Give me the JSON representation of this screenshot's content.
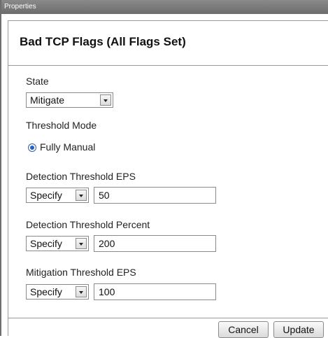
{
  "window": {
    "title": "Properties"
  },
  "panel": {
    "heading": "Bad TCP Flags (All Flags Set)"
  },
  "state": {
    "label": "State",
    "selected": "Mitigate"
  },
  "threshold_mode": {
    "label": "Threshold Mode",
    "option_label": "Fully Manual",
    "checked": true
  },
  "detection_eps": {
    "label": "Detection Threshold EPS",
    "select_value": "Specify",
    "value": "50"
  },
  "detection_percent": {
    "label": "Detection Threshold Percent",
    "select_value": "Specify",
    "value": "200"
  },
  "mitigation_eps": {
    "label": "Mitigation Threshold EPS",
    "select_value": "Specify",
    "value": "100"
  },
  "buttons": {
    "cancel": "Cancel",
    "update": "Update"
  },
  "colors": {
    "titlebar": "#7a7a7a",
    "radio_accent": "#1f5fcf"
  }
}
